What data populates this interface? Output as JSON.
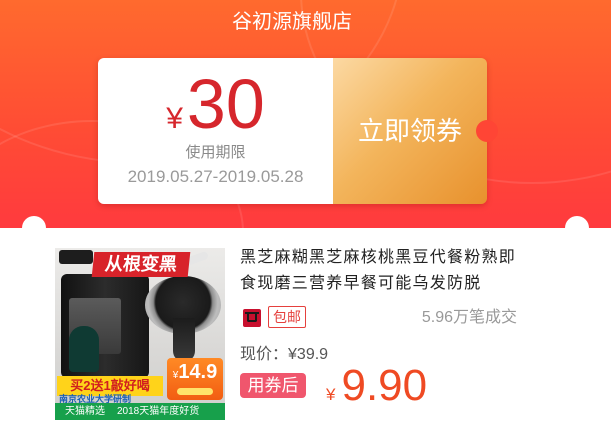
{
  "store": {
    "name": "谷初源旗舰店"
  },
  "coupon": {
    "currency": "¥",
    "amount": "30",
    "validity_label": "使用期限",
    "validity_range": "2019.05.27-2019.05.28",
    "claim_label": "立即领券"
  },
  "product": {
    "image": {
      "banner": "从根变黑",
      "promo": "买2送1敲好喝",
      "price_currency": "¥",
      "price": "14.9",
      "research": "南京农业大学研制",
      "badge_left": "天猫精选",
      "badge_right": "2018天猫年度好货"
    },
    "title": "黑芝麻糊黑芝麻核桃黑豆代餐粉熟即食现磨三营养早餐可能乌发防脱",
    "platform_icon": "tmall-icon",
    "shipping_tag": "包邮",
    "sales": "5.96万笔成交",
    "current_price_label": "现价：",
    "current_price": "¥39.9",
    "after_coupon_label": "用券后",
    "final_currency": "¥",
    "final_price": "9.90"
  },
  "colors": {
    "header_top": "#ff6a2e",
    "header_bottom": "#ff3a3e",
    "coupon_red": "#d6262c",
    "tag_red": "#e5403d",
    "badge": "#f0566d",
    "price": "#ef4a23"
  }
}
